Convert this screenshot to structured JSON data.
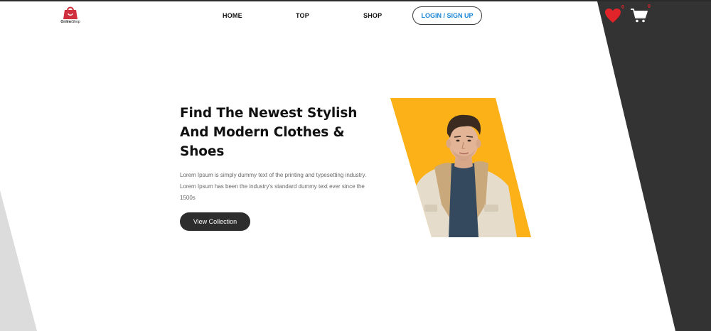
{
  "brand": {
    "name_part1": "Online",
    "name_part2": "Shop",
    "logo_icon": "shopping-bag-icon",
    "color": "#d0303d"
  },
  "nav": {
    "items": [
      {
        "label": "HOME"
      },
      {
        "label": "TOP"
      },
      {
        "label": "SHOP"
      }
    ],
    "login_label": "LOGIN / SIGN UP"
  },
  "header_icons": {
    "wishlist": {
      "icon": "heart-icon",
      "count": "0",
      "color": "#e0242a"
    },
    "cart": {
      "icon": "cart-icon",
      "count": "0"
    }
  },
  "hero": {
    "title": "Find The Newest Stylish And Modern Clothes & Shoes",
    "description": "Lorem Ipsum is simply dummy text of the printing and typesetting industry. Lorem Ipsum has been the industry's standard dummy text ever since the 1500s",
    "cta_label": "View Collection",
    "image_backdrop_color": "#fbb117"
  },
  "colors": {
    "dark": "#333333",
    "accent_blue": "#1a86d6",
    "button_dark": "#2d2d2d"
  }
}
